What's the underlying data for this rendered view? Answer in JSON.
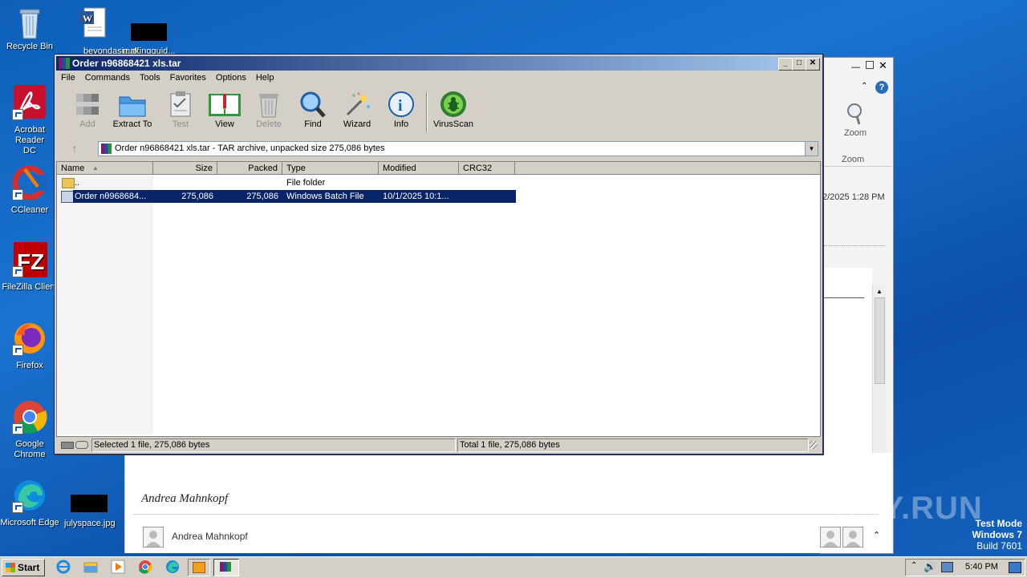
{
  "desktop": {
    "icons": [
      {
        "label": "Recycle Bin"
      },
      {
        "label": "beyondasia.rtf"
      },
      {
        "label": "makingguid..."
      },
      {
        "label": "Acrobat Reader DC"
      },
      {
        "label": "CCleaner"
      },
      {
        "label": "FileZilla Client"
      },
      {
        "label": "Firefox"
      },
      {
        "label": "Google Chrome"
      },
      {
        "label": "Microsoft Edge"
      },
      {
        "label": "julyspace.jpg"
      }
    ]
  },
  "outlook": {
    "zoom_label": "Zoom",
    "zoom_group": "Zoom",
    "date_fragment": "2/2025 1:28 PM",
    "signature": "Andrea Mahnkopf",
    "sender": "Andrea Mahnkopf"
  },
  "winrar": {
    "title": "Order n96868421 xls.tar",
    "menu": [
      "File",
      "Commands",
      "Tools",
      "Favorites",
      "Options",
      "Help"
    ],
    "tools": [
      {
        "label": "Add",
        "icon": "add-icon",
        "enabled": false
      },
      {
        "label": "Extract To",
        "icon": "folder-icon",
        "enabled": true
      },
      {
        "label": "Test",
        "icon": "clipboard-icon",
        "enabled": false
      },
      {
        "label": "View",
        "icon": "book-icon",
        "enabled": true
      },
      {
        "label": "Delete",
        "icon": "trash-icon",
        "enabled": false
      },
      {
        "label": "Find",
        "icon": "magnifier-icon",
        "enabled": true
      },
      {
        "label": "Wizard",
        "icon": "wand-icon",
        "enabled": true
      },
      {
        "label": "Info",
        "icon": "info-icon",
        "enabled": true
      },
      {
        "label": "VirusScan",
        "icon": "bug-icon",
        "enabled": true
      }
    ],
    "address": "Order n96868421 xls.tar - TAR archive, unpacked size 275,086 bytes",
    "columns": [
      "Name",
      "Size",
      "Packed",
      "Type",
      "Modified",
      "CRC32"
    ],
    "rows": [
      {
        "name": "..",
        "size": "",
        "packed": "",
        "type": "File folder",
        "modified": "",
        "crc": ""
      },
      {
        "name": "Order nθ968684...",
        "size": "275,086",
        "packed": "275,086",
        "type": "Windows Batch File",
        "modified": "10/1/2025 10:1...",
        "crc": ""
      }
    ],
    "status_left": "Selected 1 file, 275,086 bytes",
    "status_right": "Total 1 file, 275,086 bytes"
  },
  "taskbar": {
    "start": "Start",
    "clock": "5:40 PM"
  },
  "watermark": {
    "brand": "ANY.RUN",
    "mode": "Test Mode",
    "os": "Windows 7",
    "build": "Build 7601"
  },
  "colors": {
    "desktop": "#1565c0",
    "titlebar": "#0a246a",
    "selection": "#0a246a"
  }
}
